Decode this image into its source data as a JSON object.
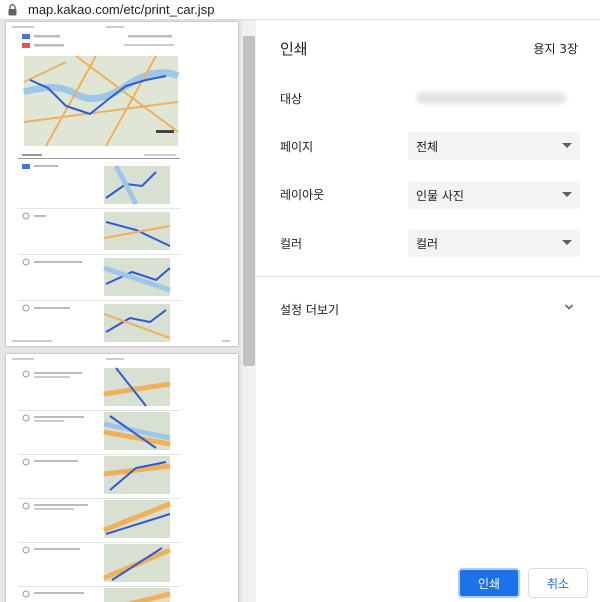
{
  "address_bar": {
    "url": "map.kakao.com/etc/print_car.jsp"
  },
  "print_dialog": {
    "title": "인쇄",
    "sheet_count": "용지 3장",
    "destination_label": "대상",
    "pages_label": "페이지",
    "pages_value": "전체",
    "layout_label": "레이아웃",
    "layout_value": "인물 사진",
    "color_label": "컬러",
    "color_value": "컬러",
    "more_settings_label": "설정 더보기",
    "print_button": "인쇄",
    "cancel_button": "취소"
  },
  "colors": {
    "accent": "#1a73e8",
    "panel_bg": "#f1f3f4",
    "preview_bg": "#e6e6e6"
  }
}
